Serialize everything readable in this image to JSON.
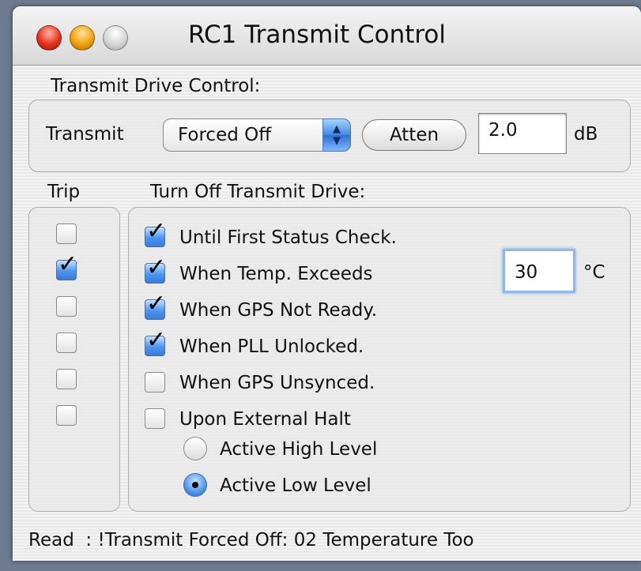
{
  "window": {
    "title": "RC1 Transmit Control"
  },
  "drive": {
    "section_label": "Transmit Drive Control:",
    "transmit_label": "Transmit",
    "mode_value": "Forced Off",
    "atten_button": "Atten",
    "atten_value": "2.0",
    "atten_unit": "dB"
  },
  "trip": {
    "label": "Trip",
    "checks": [
      false,
      true,
      false,
      false,
      false,
      false
    ]
  },
  "turnoff": {
    "label": "Turn Off Transmit Drive:",
    "options": [
      {
        "label": "Until First Status Check.",
        "checked": true
      },
      {
        "label": "When Temp. Exceeds",
        "checked": true
      },
      {
        "label": "When GPS Not Ready.",
        "checked": true
      },
      {
        "label": "When PLL Unlocked.",
        "checked": true
      },
      {
        "label": "When GPS Unsynced.",
        "checked": false
      },
      {
        "label": "Upon External Halt",
        "checked": false
      }
    ],
    "temp_value": "30",
    "temp_unit": "°C",
    "radios": [
      {
        "label": "Active High Level",
        "selected": false
      },
      {
        "label": "Active Low Level",
        "selected": true
      }
    ]
  },
  "status": {
    "text": "Read  : !Transmit Forced Off: 02 Temperature Too"
  },
  "colors": {
    "accent": "#3e88e6",
    "close": "#e2331d",
    "minimize": "#f2a10c"
  }
}
